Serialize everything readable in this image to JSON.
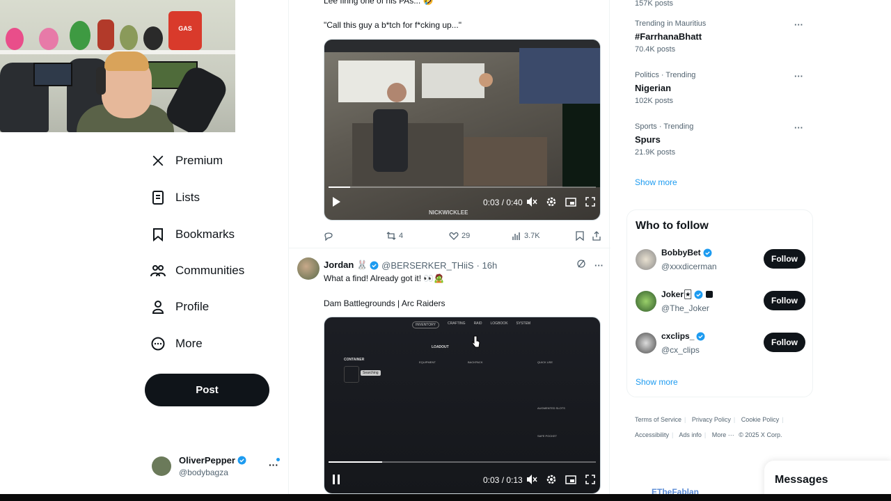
{
  "nav": {
    "items": [
      {
        "label": "Premium",
        "icon": "x-logo-icon"
      },
      {
        "label": "Lists",
        "icon": "lists-icon"
      },
      {
        "label": "Bookmarks",
        "icon": "bookmark-icon"
      },
      {
        "label": "Communities",
        "icon": "communities-icon"
      },
      {
        "label": "Profile",
        "icon": "profile-icon"
      },
      {
        "label": "More",
        "icon": "more-circle-icon"
      }
    ],
    "post_label": "Post",
    "account": {
      "name": "OliverPepper",
      "handle": "@bodybagza",
      "more": "···"
    }
  },
  "feed": {
    "tweet1": {
      "text_top": "Lee firing one of his PAs... 🤣",
      "quote": "\"Call this guy a b*tch for f*cking up...\"",
      "video": {
        "time": "0:03 / 0:40",
        "progress": 0.08,
        "watermark": "NICKWICKLEE"
      },
      "actions": {
        "reply": "",
        "retweets": "4",
        "likes": "29",
        "views": "3.7K"
      }
    },
    "tweet2": {
      "name": "Jordan 🐰",
      "handle": "@BERSERKER_THiiS",
      "time": "· 16h",
      "text": "What a find! Already got it! 👀🧟",
      "subtitle": "Dam Battlegrounds | Arc Raiders",
      "video": {
        "time": "0:03 / 0:13",
        "progress": 0.2,
        "menu": [
          "INVENTORY",
          "CRAFTING",
          "RAID",
          "LOGBOOK",
          "SYSTEM"
        ],
        "labels": {
          "loadout": "LOADOUT",
          "container": "CONTAINER",
          "searching": "Searching",
          "equipment": "EQUIPMENT",
          "backpack": "BACKPACK",
          "quick_use": "QUICK USE",
          "augmented": "AUGMENTED SLOTS",
          "safe_pocket": "SAFE POCKET"
        }
      }
    }
  },
  "right": {
    "top_count": "157K posts",
    "trends": [
      {
        "category": "Trending in Mauritius",
        "topic": "#FarrhanaBhatt",
        "count": "70.4K posts"
      },
      {
        "category": "Politics · Trending",
        "topic": "Nigerian",
        "count": "102K posts"
      },
      {
        "category": "Sports · Trending",
        "topic": "Spurs",
        "count": "21.9K posts"
      }
    ],
    "show_more": "Show more",
    "who_to_follow": {
      "title": "Who to follow",
      "users": [
        {
          "name": "BobbyBet",
          "handle": "@xxxdicerman",
          "follow": "Follow"
        },
        {
          "name": "Joker🃏",
          "handle": "@The_Joker",
          "follow": "Follow"
        },
        {
          "name": "cxclips_",
          "handle": "@cx_clips",
          "follow": "Follow"
        }
      ],
      "show_more": "Show more"
    },
    "footer": [
      "Terms of Service",
      "Privacy Policy",
      "Cookie Policy",
      "Accessibility",
      "Ads info",
      "More ···",
      "© 2025 X Corp."
    ]
  },
  "messages": {
    "label": "Messages"
  },
  "overlay": {
    "watermark": "ETheFablan",
    "gas_sign": "GAS"
  },
  "colors": {
    "accent": "#1d9bf0",
    "text": "#0f1419",
    "muted": "#536471",
    "button": "#0f1419"
  }
}
